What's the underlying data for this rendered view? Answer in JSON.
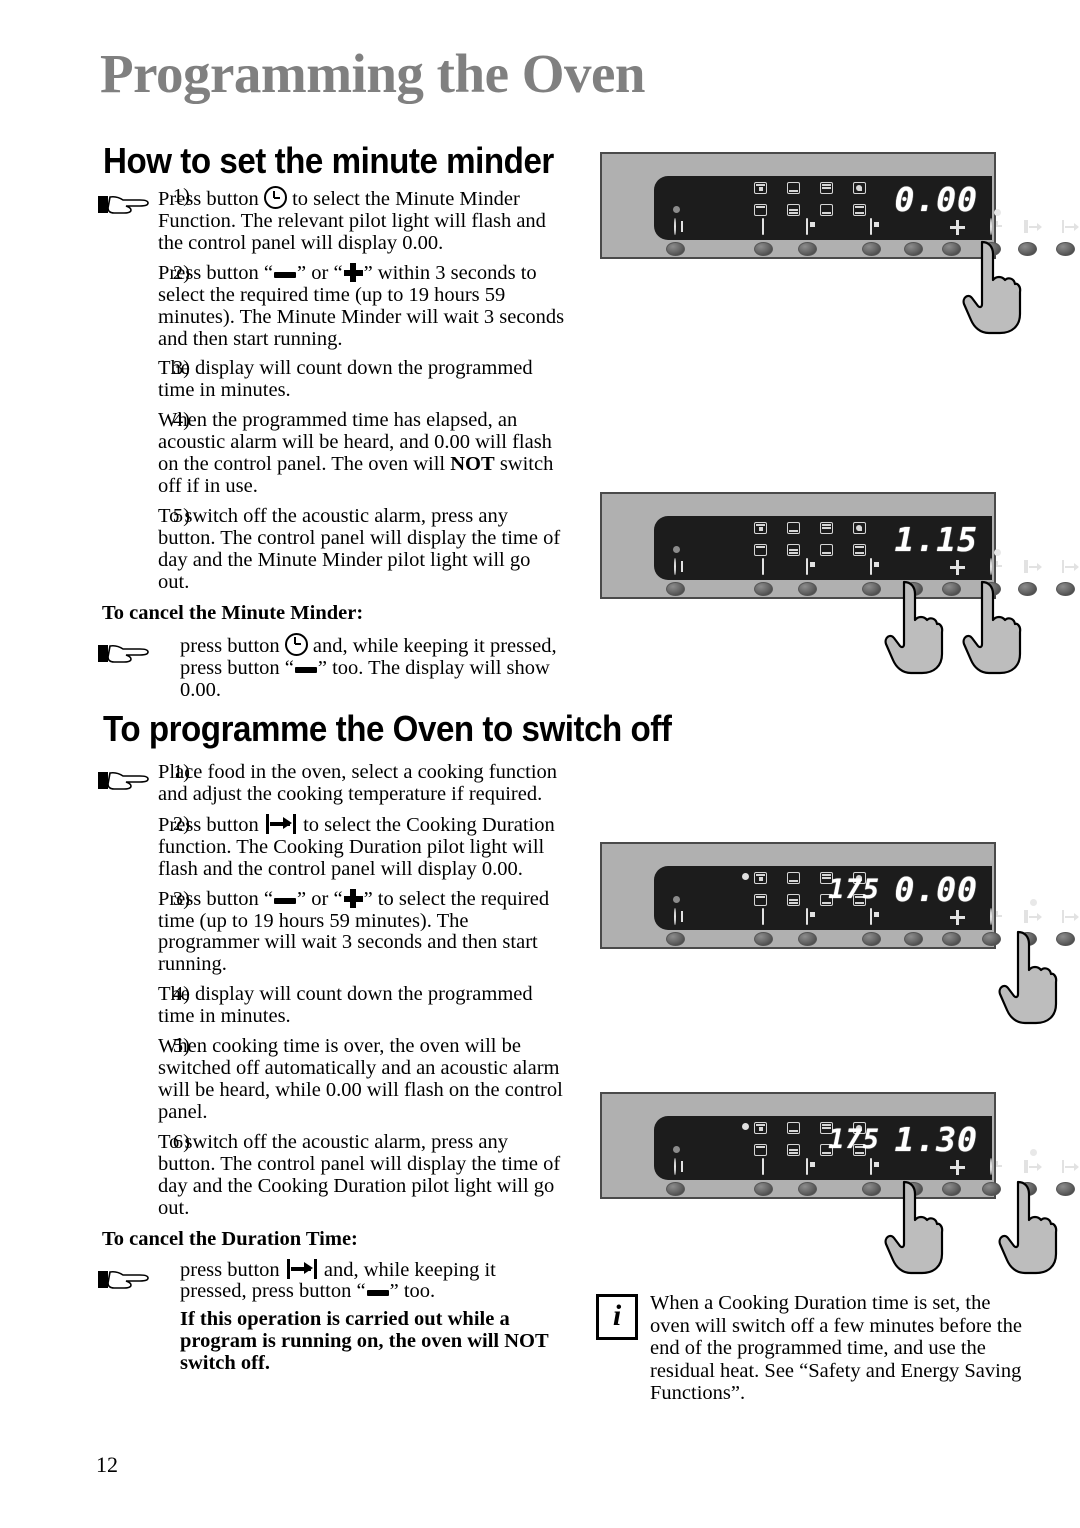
{
  "document": {
    "main_title": "Programming the Oven",
    "page_number": "12"
  },
  "sections": [
    {
      "id": "minute-minder",
      "title": "How to set the minute minder",
      "items": [
        {
          "num": "1)",
          "parts": [
            {
              "t": "Press button "
            },
            {
              "icon": "clock-icon"
            },
            {
              "t": " to select the Minute Minder Function. The relevant pilot light will flash and the control panel will display 0.00."
            }
          ]
        },
        {
          "num": "2)",
          "parts": [
            {
              "t": "Press button “"
            },
            {
              "icon": "minus-icon"
            },
            {
              "t": "” or “"
            },
            {
              "icon": "plus-icon"
            },
            {
              "t": "” within 3 seconds to select the required time (up to 19 hours 59 minutes). The Minute Minder will wait 3 seconds and then start running."
            }
          ]
        },
        {
          "num": "3)",
          "parts": [
            {
              "t": "The display will count down the programmed time in minutes."
            }
          ]
        },
        {
          "num": "4)",
          "parts": [
            {
              "t": "When the programmed time has elapsed, an acoustic alarm will be heard, and 0.00 will flash on the control panel. The oven will "
            },
            {
              "t": "NOT",
              "bold": true
            },
            {
              "t": " switch off if in use."
            }
          ]
        },
        {
          "num": "5)",
          "parts": [
            {
              "t": "To switch off the acoustic alarm, press any button. The control panel will display the time of day and the Minute Minder pilot light will go out."
            }
          ]
        }
      ],
      "cancel_head": "To cancel the Minute Minder:",
      "cancel_parts": [
        {
          "t": "press button "
        },
        {
          "icon": "clock-icon"
        },
        {
          "t": " and, while keeping it pressed, press button “"
        },
        {
          "icon": "minus-icon"
        },
        {
          "t": "” too. The display will show 0.00."
        }
      ]
    },
    {
      "id": "switch-off",
      "title": "To programme the Oven to switch off",
      "items": [
        {
          "num": "1)",
          "parts": [
            {
              "t": "Place food in the oven, select a cooking function and adjust the cooking temperature if required."
            }
          ]
        },
        {
          "num": "2)",
          "parts": [
            {
              "t": "Press button "
            },
            {
              "icon": "duration-icon"
            },
            {
              "t": " to select the Cooking Duration function. The Cooking Duration pilot light will flash and the control panel will display 0.00."
            }
          ]
        },
        {
          "num": "3)",
          "parts": [
            {
              "t": "Press button “"
            },
            {
              "icon": "minus-icon"
            },
            {
              "t": "” or “"
            },
            {
              "icon": "plus-icon"
            },
            {
              "t": "” to select the required time (up to 19 hours 59 minutes). The programmer will wait 3 seconds and then start running."
            }
          ]
        },
        {
          "num": "4)",
          "parts": [
            {
              "t": "The display will count down the programmed time in minutes."
            }
          ]
        },
        {
          "num": "5)",
          "parts": [
            {
              "t": "When cooking time is over, the oven will be switched off automatically and an acoustic alarm will be heard, while 0.00 will flash on the control panel."
            }
          ]
        },
        {
          "num": "6)",
          "parts": [
            {
              "t": "To switch off the acoustic alarm, press any button. The control panel will display the time of day and the Cooking Duration pilot light will go out."
            }
          ]
        }
      ],
      "cancel_head": "To cancel the Duration Time:",
      "cancel_parts": [
        {
          "t": "press button "
        },
        {
          "icon": "duration-icon"
        },
        {
          "t": " and, while keeping it pressed, press button “"
        },
        {
          "icon": "minus-icon"
        },
        {
          "t": "” too."
        }
      ],
      "warning": "If this operation is carried out while a program is running on, the oven will NOT switch off."
    }
  ],
  "info_note": {
    "icon": "info-icon",
    "text": "When a Cooking Duration time is set, the oven will switch off a few minutes before the end of the programmed time, and use the residual heat. See “Safety and Energy Saving Functions”."
  },
  "panels": [
    {
      "id": "panel-minute-minder-start",
      "display_main": "0.00",
      "display_temp": "",
      "active_pilot": "minute-minder",
      "fingers": [
        "clock"
      ]
    },
    {
      "id": "panel-minute-minder-set",
      "display_main": "1.15",
      "display_temp": "",
      "active_pilot": "minute-minder",
      "fingers": [
        "minus",
        "clock"
      ]
    },
    {
      "id": "panel-duration-start",
      "display_main": "0.00",
      "display_temp": "175",
      "active_pilot": "duration",
      "fingers": [
        "duration"
      ]
    },
    {
      "id": "panel-duration-set",
      "display_main": "1.30",
      "display_temp": "175",
      "active_pilot": "duration",
      "fingers": [
        "minus",
        "duration"
      ]
    }
  ],
  "colors": {
    "title_gray": "#808080",
    "panel_body": "#b0b0b0",
    "panel_border": "#4a4a4a",
    "lcd_bg": "#1c1c1c",
    "lcd_text": "#ffffff",
    "hand_fill": "#bdbdbd"
  }
}
